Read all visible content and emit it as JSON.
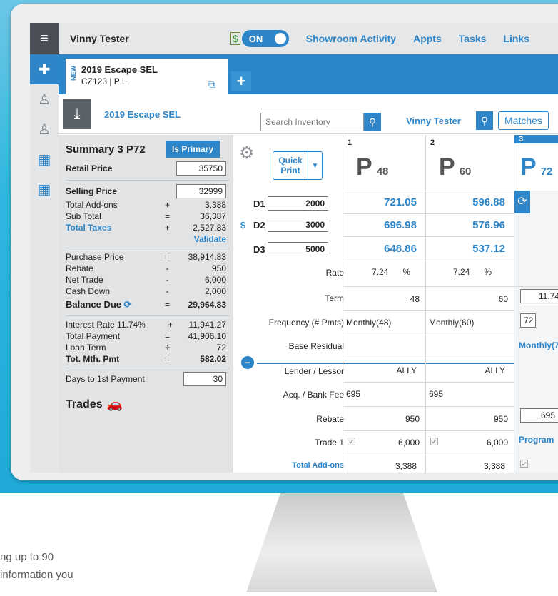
{
  "promo": {
    "line1": "ng up to 90",
    "line2": "information you"
  },
  "topbar": {
    "user": "Vinny Tester",
    "toggle": "ON",
    "money_icon": "$",
    "nav": [
      "Showroom Activity",
      "Appts",
      "Tasks",
      "Links"
    ]
  },
  "tab": {
    "new": "NEW",
    "title": "2019 Escape SEL",
    "subtitle": "CZ123 | P L",
    "plus": "+"
  },
  "vehicle": {
    "name": "2019 Escape SEL",
    "search_placeholder": "Search Inventory",
    "salesperson": "Vinny Tester",
    "matches": "Matches"
  },
  "summary": {
    "title": "Summary 3 P72",
    "primary": "Is Primary",
    "retail_label": "Retail Price",
    "retail": "35750",
    "selling_label": "Selling Price",
    "selling": "32999",
    "addons_label": "Total Add-ons",
    "addons_op": "+",
    "addons": "3,388",
    "subtotal_label": "Sub Total",
    "subtotal_op": "=",
    "subtotal": "36,387",
    "taxes_label": "Total Taxes",
    "taxes_op": "+",
    "taxes": "2,527.83",
    "validate": "Validate",
    "purchase_label": "Purchase Price",
    "purchase_op": "=",
    "purchase": "38,914.83",
    "rebate_label": "Rebate",
    "rebate_op": "-",
    "rebate": "950",
    "nettrade_label": "Net Trade",
    "nettrade_op": "-",
    "nettrade": "6,000",
    "cashdown_label": "Cash Down",
    "cashdown_op": "-",
    "cashdown": "2,000",
    "balance_label": "Balance Due",
    "balance_op": "=",
    "balance": "29,964.83",
    "interest_label": "Interest Rate 11.74%",
    "interest_op": "+",
    "interest": "11,941.27",
    "totalpay_label": "Total Payment",
    "totalpay_op": "=",
    "totalpay": "41,906.10",
    "loanterm_label": "Loan Term",
    "loanterm_op": "÷",
    "loanterm": "72",
    "mth_label": "Tot. Mth. Pmt",
    "mth_op": "=",
    "mth": "582.02",
    "days_label": "Days to 1st Payment",
    "days": "30",
    "trades": "Trades"
  },
  "quickprint": {
    "line1": "Quick",
    "line2": "Print"
  },
  "downs": [
    {
      "label": "D1",
      "value": "2000"
    },
    {
      "label": "D2",
      "value": "3000",
      "prefix": "$"
    },
    {
      "label": "D3",
      "value": "5000"
    }
  ],
  "rows": {
    "rate": "Rate",
    "term": "Term",
    "frequency": "Frequency (# Pmts)",
    "residual": "Base Residual",
    "lender": "Lender / Lessor",
    "fee": "Acq. / Bank Fee",
    "rebate": "Rebate",
    "trade": "Trade 1",
    "addons": "Total Add-ons"
  },
  "columns": [
    {
      "num": "1",
      "letter": "P",
      "term": "48",
      "pays": [
        "721.05",
        "696.98",
        "648.86"
      ],
      "rate": "7.24",
      "pct": "%",
      "term_val": "48",
      "freq": "Monthly(48)",
      "lender": "ALLY",
      "fee": "695",
      "rebate": "950",
      "trade": "6,000",
      "addons": "3,388"
    },
    {
      "num": "2",
      "letter": "P",
      "term": "60",
      "pays": [
        "596.88",
        "576.96",
        "537.12"
      ],
      "rate": "7.24",
      "pct": "%",
      "term_val": "60",
      "freq": "Monthly(60)",
      "lender": "ALLY",
      "fee": "695",
      "rebate": "950",
      "trade": "6,000",
      "addons": "3,388"
    },
    {
      "num": "3",
      "letter": "P",
      "term": "72",
      "rate": "11.74",
      "term_val": "72",
      "freq": "Monthly(7",
      "fee": "695",
      "rebate": "Program"
    }
  ],
  "colors": {
    "accent": "#2e86c9",
    "sidebar": "#4a4f57"
  }
}
